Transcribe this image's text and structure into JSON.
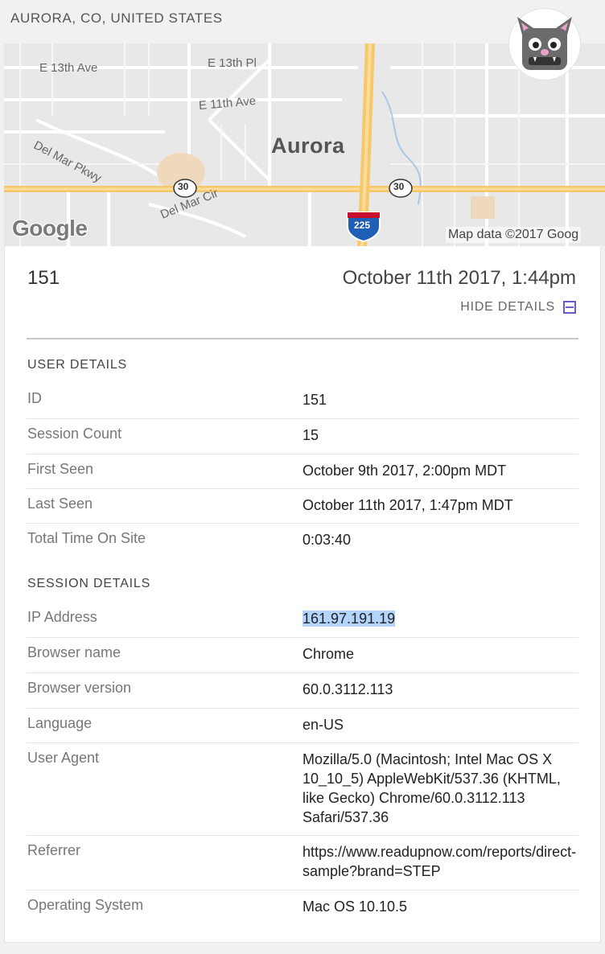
{
  "location": {
    "label": "AURORA, CO, UNITED STATES"
  },
  "map": {
    "streets": [
      "E 13th Ave",
      "E 13th Pl",
      "E 11th Ave",
      "Del Mar Pkwy",
      "Del Mar Cir"
    ],
    "city": "Aurora",
    "route_30": "30",
    "route_225": "225",
    "logo": "Google",
    "attribution": "Map data ©2017 Goog"
  },
  "summary": {
    "id": "151",
    "datetime": "October 11th 2017, 1:44pm",
    "hide_details_label": "HIDE DETAILS",
    "hide_icon": "collapse-icon"
  },
  "user_details": {
    "title": "USER DETAILS",
    "rows": [
      {
        "key": "ID",
        "value": "151"
      },
      {
        "key": "Session Count",
        "value": "15"
      },
      {
        "key": "First Seen",
        "value": "October 9th 2017, 2:00pm MDT"
      },
      {
        "key": "Last Seen",
        "value": "October 11th 2017, 1:47pm MDT"
      },
      {
        "key": "Total Time On Site",
        "value": "0:03:40"
      }
    ]
  },
  "session_details": {
    "title": "SESSION DETAILS",
    "rows": [
      {
        "key": "IP Address",
        "value": "161.97.191.19"
      },
      {
        "key": "Browser name",
        "value": "Chrome"
      },
      {
        "key": "Browser version",
        "value": "60.0.3112.113"
      },
      {
        "key": "Language",
        "value": "en-US"
      },
      {
        "key": "User Agent",
        "value": "Mozilla/5.0 (Macintosh; Intel Mac OS X 10_10_5) AppleWebKit/537.36 (KHTML, like Gecko) Chrome/60.0.3112.113 Safari/537.36"
      },
      {
        "key": "Referrer",
        "value": "https://www.readupnow.com/reports/direct-sample?brand=STEP"
      },
      {
        "key": "Operating System",
        "value": "Mac OS 10.10.5"
      }
    ]
  },
  "colors": {
    "accent": "#6a5acd",
    "highlight": "#b3d4fc",
    "road": "#f6c86b"
  }
}
